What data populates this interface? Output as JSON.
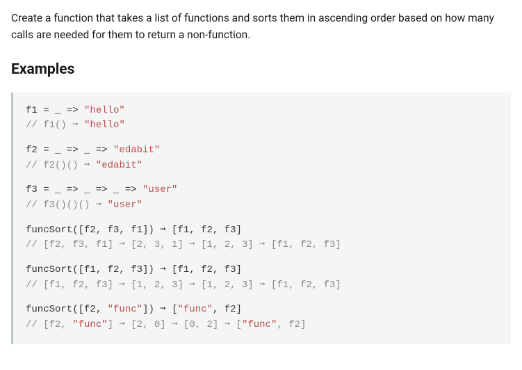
{
  "description": "Create a function that takes a list of functions and sorts them in ascending order based on how many calls are needed for them to return a non-function.",
  "examples_heading": "Examples",
  "code": {
    "g1": {
      "l1a": "f1 = _ => ",
      "l1s": "\"hello\"",
      "l2a": "// f1() ➞ ",
      "l2s": "\"hello\""
    },
    "g2": {
      "l1a": "f2 = _ => _ => ",
      "l1s": "\"edabit\"",
      "l2a": "// f2()() ➞ ",
      "l2s": "\"edabit\""
    },
    "g3": {
      "l1a": "f3 = _ => _ => _ => ",
      "l1s": "\"user\"",
      "l2a": "// f3()()() ➞ ",
      "l2s": "\"user\""
    },
    "g4": {
      "l1": "funcSort([f2, f3, f1]) ➞ [f1, f2, f3]",
      "l2": "// [f2, f3, f1] ➞ [2, 3, 1] ➞ [1, 2, 3] ➞ [f1, f2, f3]"
    },
    "g5": {
      "l1": "funcSort([f1, f2, f3]) ➞ [f1, f2, f3]",
      "l2": "// [f1, f2, f3] ➞ [1, 2, 3] ➞ [1, 2, 3] ➞ [f1, f2, f3]"
    },
    "g6": {
      "l1a": "funcSort([f2, ",
      "l1s": "\"func\"",
      "l1b": "]) ➞ [",
      "l1s2": "\"func\"",
      "l1c": ", f2]",
      "l2a": "// [f2, ",
      "l2s": "\"func\"",
      "l2b": "] ➞ [2, 0] ➞ [0, 2] ➞ [",
      "l2s2": "\"func\"",
      "l2c": ", f2]"
    }
  }
}
